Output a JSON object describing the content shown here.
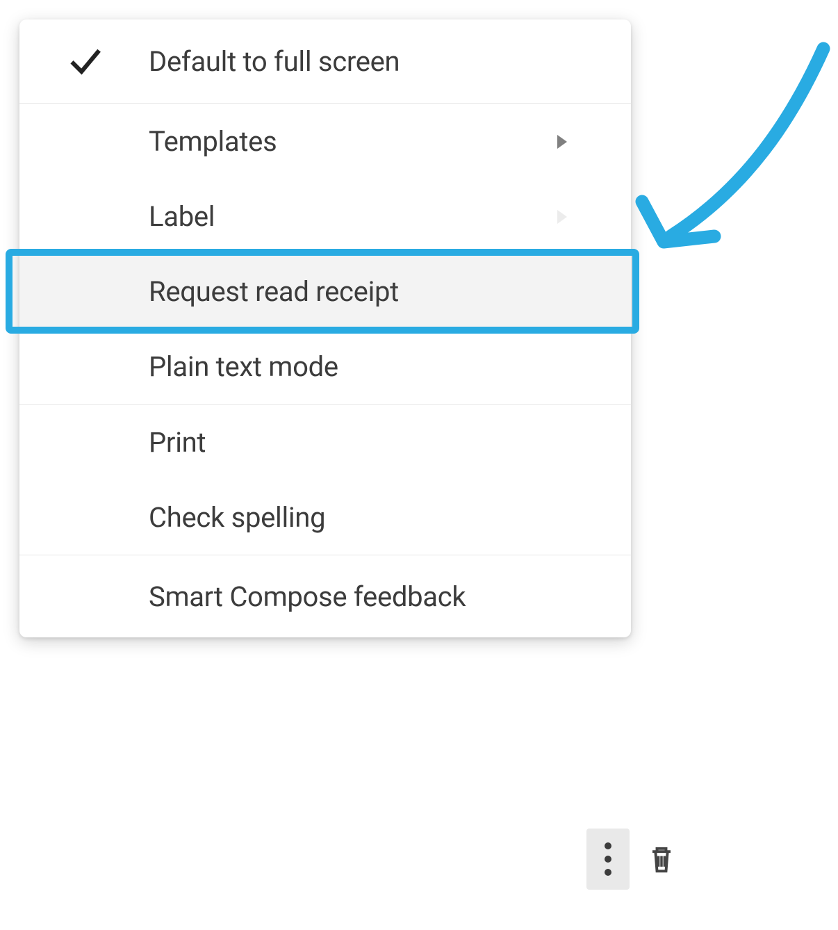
{
  "menu": {
    "items": [
      {
        "label": "Default to full screen",
        "checked": true,
        "hasSubmenu": false
      },
      {
        "label": "Templates",
        "checked": false,
        "hasSubmenu": true
      },
      {
        "label": "Label",
        "checked": false,
        "hasSubmenu": true
      },
      {
        "label": "Request read receipt",
        "checked": false,
        "hasSubmenu": false,
        "highlighted": true
      },
      {
        "label": "Plain text mode",
        "checked": false,
        "hasSubmenu": false
      },
      {
        "label": "Print",
        "checked": false,
        "hasSubmenu": false
      },
      {
        "label": "Check spelling",
        "checked": false,
        "hasSubmenu": false
      },
      {
        "label": "Smart Compose feedback",
        "checked": false,
        "hasSubmenu": false
      }
    ]
  },
  "annotation": {
    "highlight_color": "#29abe2",
    "arrow_color": "#29abe2"
  }
}
